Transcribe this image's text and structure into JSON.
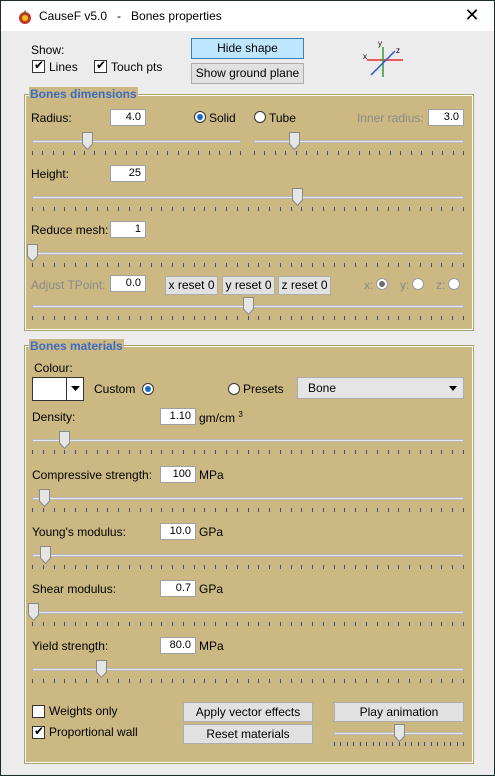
{
  "window": {
    "title": "CauseF v5.0   -   Bones properties",
    "close_glyph": "✕"
  },
  "show": {
    "label": "Show:",
    "lines": {
      "label": "Lines",
      "checked": true
    },
    "touch": {
      "label": "Touch pts",
      "checked": true
    }
  },
  "buttons": {
    "hide_shape": "Hide shape",
    "ground": "Show ground plane",
    "apply": "Apply vector effects",
    "reset": "Reset materials",
    "play": "Play animation"
  },
  "axes_icon": {
    "x": "x",
    "y": "y",
    "z": "z"
  },
  "dimensions": {
    "title": "Bones dimensions",
    "radius": {
      "label": "Radius:",
      "value": "4.0",
      "level": 0.26
    },
    "solid": "Solid",
    "tube": "Tube",
    "inner": {
      "label": "Inner radius:",
      "value": "3.0",
      "level": 0.19
    },
    "height": {
      "label": "Height:",
      "value": "25",
      "level": 0.62
    },
    "reduce": {
      "label": "Reduce mesh:",
      "value": "1",
      "level": 0.0
    },
    "tpoint": {
      "label": "Adjust TPoint:",
      "value": "0.0",
      "level": 0.5
    },
    "xreset": "x reset 0",
    "yreset": "y reset 0",
    "zreset": "z reset 0",
    "ax_x": "x:",
    "ax_y": "y:",
    "ax_z": "z:"
  },
  "materials": {
    "title": "Bones materials",
    "colour": "Colour:",
    "custom": "Custom",
    "presets": "Presets",
    "preset_value": "Bone",
    "density": {
      "label": "Density:",
      "value": "1.10",
      "unit": "gm/cm",
      "unit_sup": "3",
      "level": 0.07
    },
    "compressive": {
      "label": "Compressive strength:",
      "value": "100",
      "unit": "MPa",
      "level": 0.02
    },
    "young": {
      "label": "Young's modulus:",
      "value": "10.0",
      "unit": "GPa",
      "level": 0.02
    },
    "shear": {
      "label": "Shear modulus:",
      "value": "0.7",
      "unit": "GPa",
      "level": 0.0
    },
    "yield": {
      "label": "Yield strength:",
      "value": "80.0",
      "unit": "MPa",
      "level": 0.16
    }
  },
  "footer": {
    "weights": {
      "label": "Weights only",
      "checked": false
    },
    "wall": {
      "label": "Proportional wall",
      "checked": true
    },
    "anim_level": 0.5
  }
}
